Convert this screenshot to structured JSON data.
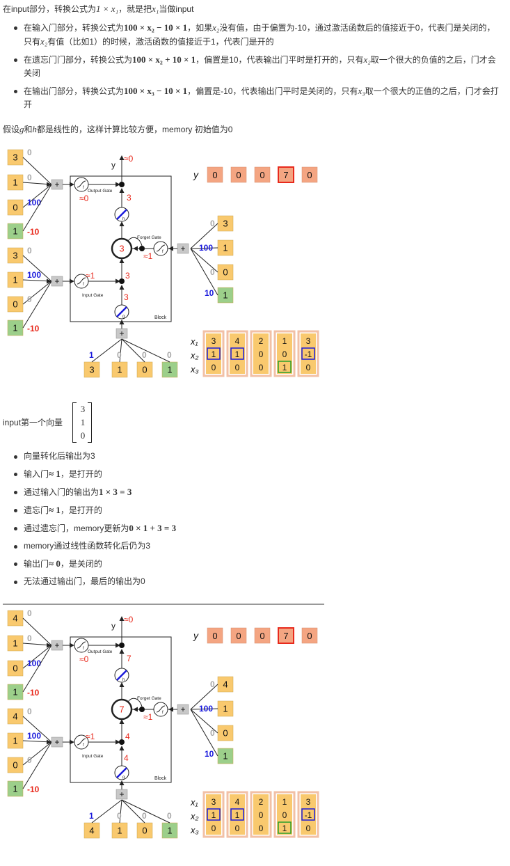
{
  "intro": {
    "pre": "在input部分，转换公式为",
    "formula": "1 × x₁",
    "mid": "，就是把",
    "var": "x₁",
    "post": "当做input"
  },
  "gate_bullets": [
    {
      "pre": "在输入门部分，转换公式为",
      "formula": "100 × x₂ − 10 × 1",
      "mid": "，如果",
      "var": "x₂",
      "post": "没有值，由于偏置为-10，通过激活函数后的值接近于0，代表门是关闭的，只有",
      "var2": "x₂",
      "post2": "有值（比如1）的时候，激活函数的值接近于1，代表门是开的"
    },
    {
      "pre": "在遗忘门门部分，转换公式为",
      "formula": "100 × x₂ + 10 × 1",
      "mid": "，偏置是10，代表输出门平时是打开的，只有",
      "var": "x₂",
      "post": "取一个很大的负值的之后，门才会关闭"
    },
    {
      "pre": "在输出门部分，转换公式为",
      "formula": "100 × x₃ − 10 × 1",
      "mid": "，偏置是-10，代表输出门平时是关闭的，只有",
      "var": "x₃",
      "post": "取一个很大的正值的之后，门才会打开"
    }
  ],
  "assume": {
    "pre": "假设",
    "g": "g",
    "and": "和",
    "h": "h",
    "post": "都是线性的，这样计算比较方便，memory 初始值为0"
  },
  "input_line": {
    "label": "input第一个向量",
    "vector": [
      "3",
      "1",
      "0"
    ]
  },
  "steps": [
    {
      "pre": "向量转化后输出为3"
    },
    {
      "pre": "输入门",
      "math": "≈ 1",
      "post": "，是打开的"
    },
    {
      "pre": "通过输入门的输出为",
      "math": "1 × 3 = 3",
      "post": ""
    },
    {
      "pre": "遗忘门",
      "math": "≈ 1",
      "post": "，是打开的"
    },
    {
      "pre": "通过遗忘门，memory更新为",
      "math": "0 × 1 + 3 = 3",
      "post": ""
    },
    {
      "pre": "memory通过线性函数转化后仍为3"
    },
    {
      "pre": "输出门",
      "math": "≈ 0",
      "post": "，是关闭的"
    },
    {
      "pre": "无法通过输出门，最后的输出为0"
    }
  ],
  "diagram_common": {
    "y_label": "y",
    "approx0": "≈0",
    "approx1": "≈1",
    "output_gate": "Output Gate",
    "forget_gate": "Forget Gate",
    "input_gate": "Input Gate",
    "block": "Block",
    "plus": "+",
    "f": "f",
    "h": "h",
    "g": "g",
    "w0": "0",
    "w100": "100",
    "wm10": "-10",
    "w10": "10",
    "w1": "1",
    "one": "1",
    "x1": "x₁",
    "x2": "x₂",
    "x3": "x₃",
    "y_values": [
      "0",
      "0",
      "0",
      "7",
      "0"
    ],
    "seq_x1": [
      "3",
      "4",
      "2",
      "1",
      "3"
    ],
    "seq_x2": [
      "1",
      "1",
      "0",
      "0",
      "-1"
    ],
    "seq_x3": [
      "0",
      "0",
      "0",
      "1",
      "0"
    ]
  },
  "diagrams": [
    {
      "x1": "3",
      "mem": "3",
      "val_g": "3",
      "val_in": "3",
      "val_h": "3"
    },
    {
      "x1": "4",
      "mem": "7",
      "val_g": "4",
      "val_in": "4",
      "val_h": "7"
    }
  ],
  "colors": {
    "orange": "#f9c96e",
    "green": "#9ccf8a",
    "salmon": "#f4a582",
    "red": "#e8291c",
    "blue": "#1a1adc",
    "gray": "#a6a6a6"
  }
}
